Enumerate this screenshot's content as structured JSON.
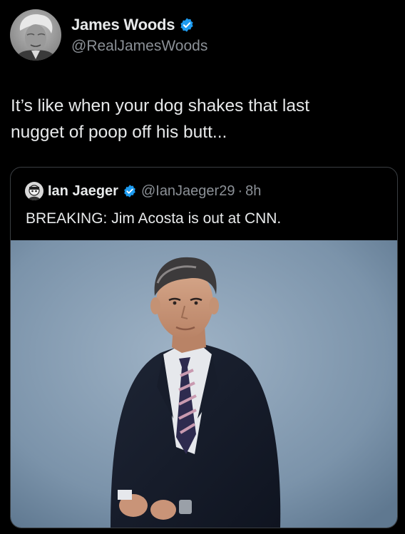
{
  "tweet": {
    "author": {
      "name": "James Woods",
      "handle": "@RealJamesWoods",
      "verified": true,
      "avatar_icon": "avatar-photo"
    },
    "text": "It’s like when your dog shakes that last\nnugget of poop off his butt...",
    "quote": {
      "author": {
        "name": "Ian Jaeger",
        "handle": "@IanJaeger29",
        "separator": "·",
        "time": "8h",
        "verified": true,
        "avatar_icon": "avatar-photo"
      },
      "text": "BREAKING: Jim Acosta is out at CNN.",
      "media": {
        "type": "photo"
      }
    }
  },
  "colors": {
    "background": "#000000",
    "text_primary": "#e7e9ea",
    "text_secondary": "#8b9096",
    "verified_badge": "#1d9bf0",
    "card_border": "#3a3e42"
  }
}
